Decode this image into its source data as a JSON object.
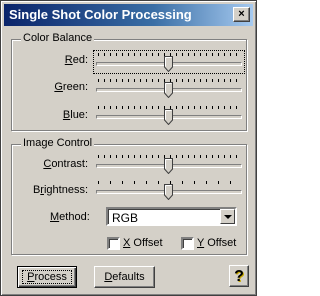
{
  "window": {
    "title": "Single Shot Color Processing",
    "close_glyph": "×",
    "titlebar_colors": [
      "#0a246a",
      "#a6caf0"
    ]
  },
  "color_balance": {
    "group_title": "Color Balance",
    "sliders": [
      {
        "label_u": "R",
        "label_rest": "ed:",
        "level": 0.5
      },
      {
        "label_u": "G",
        "label_rest": "reen:",
        "level": 0.5
      },
      {
        "label_u": "B",
        "label_rest": "lue:",
        "level": 0.5
      }
    ]
  },
  "image_control": {
    "group_title": "Image Control",
    "sliders": [
      {
        "label_u": "C",
        "label_rest": "ontrast:",
        "level": 0.5
      },
      {
        "label_pre": "B",
        "label_u": "r",
        "label_rest": "ightness:",
        "level": 0.5
      }
    ],
    "method": {
      "label_u": "M",
      "label_rest": "ethod:",
      "value": "RGB"
    },
    "x_offset": {
      "label_u": "X",
      "label_rest": " Offset",
      "checked": false
    },
    "y_offset": {
      "label_u": "Y",
      "label_rest": " Offset",
      "checked": false
    }
  },
  "buttons": {
    "process": {
      "label_u": "P",
      "label_rest": "rocess"
    },
    "defaults": {
      "label_u": "D",
      "label_rest": "efaults"
    },
    "help_glyph": "?"
  }
}
